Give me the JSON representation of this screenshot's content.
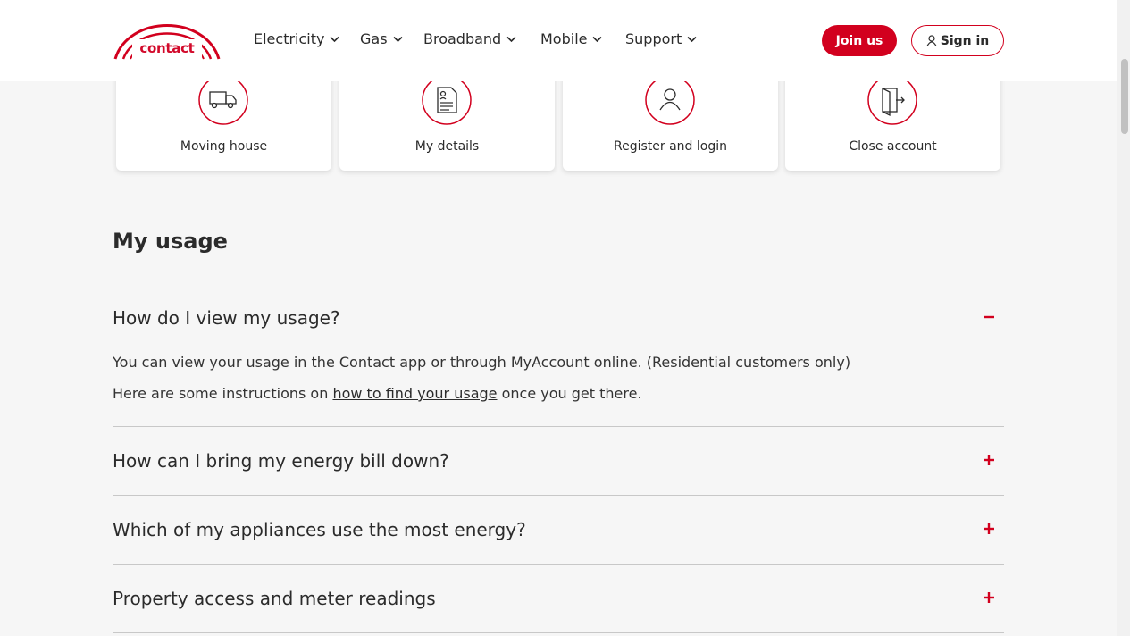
{
  "brand": {
    "logo_text": "contact",
    "accent": "#d2001e"
  },
  "nav": {
    "items": [
      {
        "label": "Electricity"
      },
      {
        "label": "Gas"
      },
      {
        "label": "Broadband"
      },
      {
        "label": "Mobile"
      },
      {
        "label": "Support"
      }
    ],
    "join_label": "Join us",
    "sign_in_label": "Sign in"
  },
  "cards": [
    {
      "label": "Moving house",
      "icon": "truck-icon"
    },
    {
      "label": "My details",
      "icon": "document-icon"
    },
    {
      "label": "Register and login",
      "icon": "user-icon"
    },
    {
      "label": "Close account",
      "icon": "door-exit-icon"
    }
  ],
  "usage": {
    "title": "My usage",
    "faqs": [
      {
        "question": "How do I view my usage?",
        "expanded": true,
        "answer_p1": "You can view your usage in the Contact app or through MyAccount online. (Residential customers only)",
        "answer_p2_before": "Here are some instructions on ",
        "answer_p2_link": "how to find your usage",
        "answer_p2_after": " once you get there."
      },
      {
        "question": "How can I bring my energy bill down?",
        "expanded": false
      },
      {
        "question": "Which of my appliances use the most energy?",
        "expanded": false
      },
      {
        "question": "Property access and meter readings",
        "expanded": false
      }
    ]
  }
}
